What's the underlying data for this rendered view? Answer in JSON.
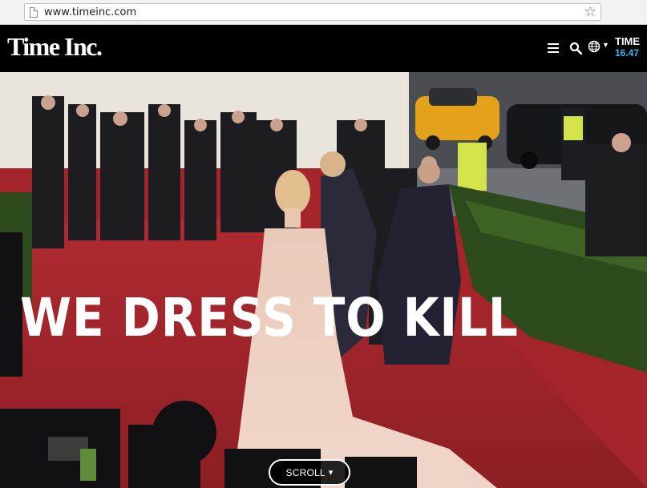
{
  "browser": {
    "url": "www.timeinc.com"
  },
  "header": {
    "logo": "Time Inc.",
    "ticker_name": "TIME",
    "ticker_value": "16.47",
    "accent_color": "#35b7ef",
    "icons": [
      "page-icon",
      "bookmark-star-icon",
      "menu-icon",
      "search-icon",
      "globe-icon",
      "chevron-down-icon"
    ]
  },
  "hero": {
    "headline": "WE DRESS TO KILL",
    "scroll_label": "SCROLL",
    "carpet_color": "#a3252b"
  }
}
